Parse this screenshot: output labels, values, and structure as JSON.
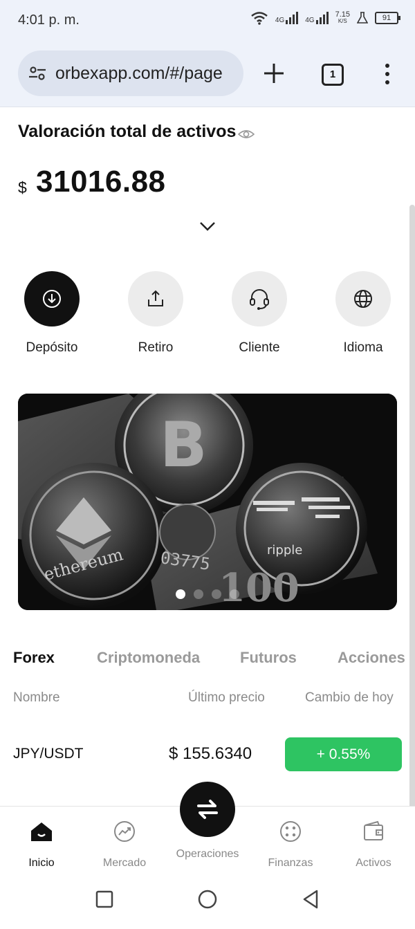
{
  "status_bar": {
    "time": "4:01 p. m.",
    "net1": "4G",
    "net2": "4G",
    "speed_value": "7.15",
    "speed_unit": "K/S",
    "battery": "91"
  },
  "browser": {
    "url": "orbexapp.com/#/page",
    "tab_count": "1",
    "icons": [
      "tune-icon",
      "plus-icon",
      "tabs-icon",
      "more-vert-icon"
    ]
  },
  "assets": {
    "title": "Valoración total de activos",
    "currency_symbol": "$",
    "amount": "31016.88"
  },
  "actions": [
    {
      "label": "Depósito",
      "icon": "download-icon"
    },
    {
      "label": "Retiro",
      "icon": "upload-icon"
    },
    {
      "label": "Cliente",
      "icon": "headset-icon"
    },
    {
      "label": "Idioma",
      "icon": "globe-icon"
    }
  ],
  "banner": {
    "slides": 4,
    "active_slide": 1,
    "text_ethereum": "ethereum",
    "text_ripple": "ripple",
    "text_note": "03775",
    "text_bill": "100"
  },
  "market_tabs": [
    "Forex",
    "Criptomoneda",
    "Futuros",
    "Acciones"
  ],
  "active_market_tab": 0,
  "table": {
    "headers": [
      "Nombre",
      "Último precio",
      "Cambio de hoy"
    ],
    "rows": [
      {
        "name": "JPY/USDT",
        "price": "$ 155.6340",
        "change": "+ 0.55%"
      }
    ]
  },
  "bottom_nav": {
    "items": [
      {
        "label": "Inicio",
        "icon": "home-icon"
      },
      {
        "label": "Mercado",
        "icon": "trend-icon"
      },
      {
        "label": "Operaciones",
        "icon": "swap-icon"
      },
      {
        "label": "Finanzas",
        "icon": "grid-dots-icon"
      },
      {
        "label": "Activos",
        "icon": "wallet-icon"
      }
    ],
    "active": 0
  },
  "colors": {
    "accent_green": "#2ec462",
    "dark": "#111111",
    "browser_bg": "#eef2fa"
  }
}
